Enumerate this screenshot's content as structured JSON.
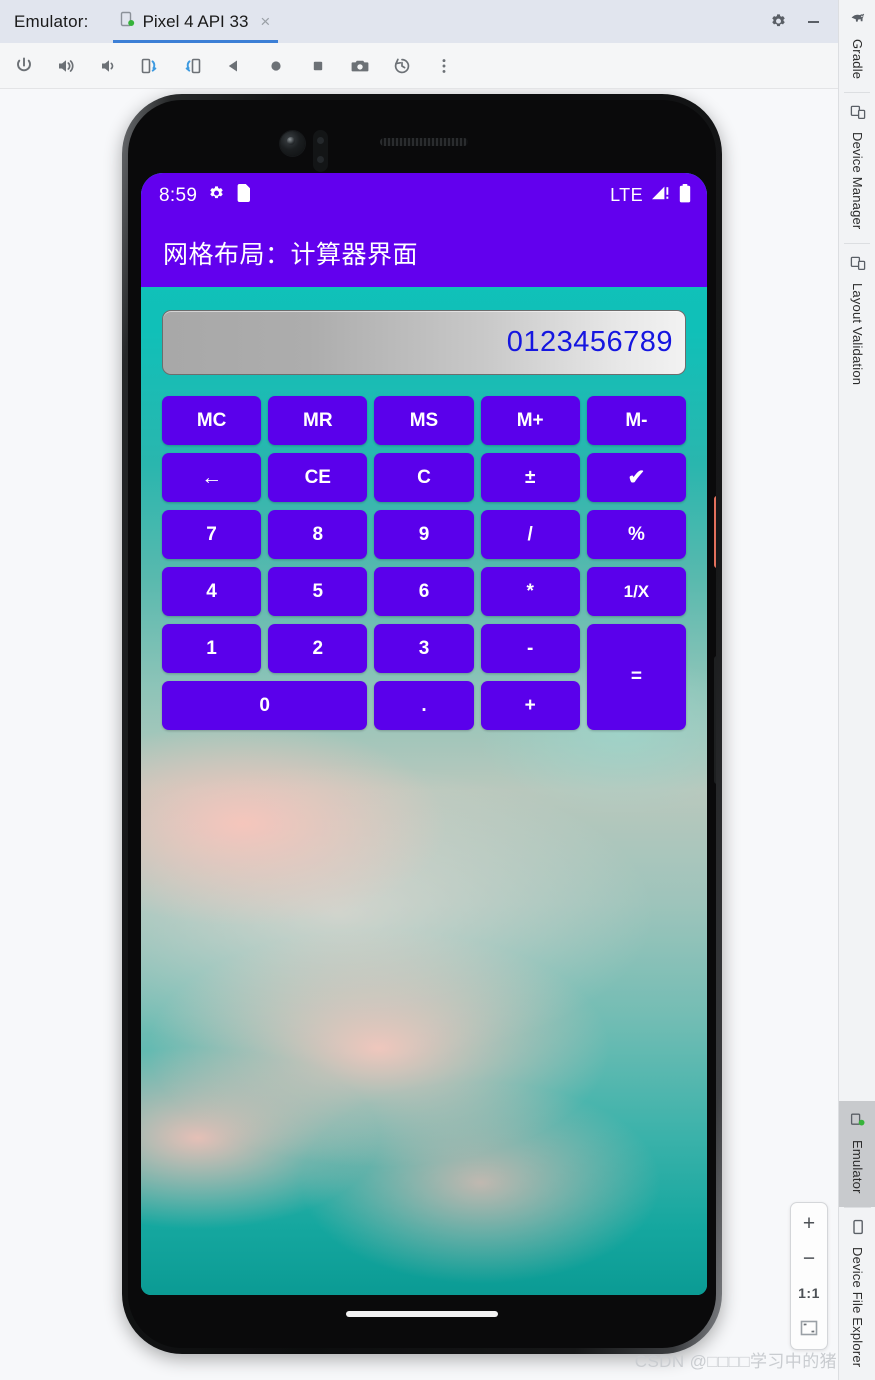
{
  "ide": {
    "window_title": "Emulator:",
    "tab": {
      "label": "Pixel 4 API 33",
      "close": "×",
      "icon": "device-phone-icon"
    },
    "header_actions": [
      {
        "name": "settings-gear",
        "icon": "gear-icon"
      },
      {
        "name": "minimize",
        "icon": "minimize-icon"
      }
    ],
    "toolbar": [
      {
        "name": "power",
        "icon": "power-icon"
      },
      {
        "name": "volume-up",
        "icon": "volume-up-icon"
      },
      {
        "name": "volume-down",
        "icon": "volume-down-icon"
      },
      {
        "name": "rotate-left",
        "icon": "rotate-left-icon"
      },
      {
        "name": "rotate-right",
        "icon": "rotate-right-icon"
      },
      {
        "name": "back",
        "icon": "back-triangle-icon"
      },
      {
        "name": "home",
        "icon": "home-circle-icon"
      },
      {
        "name": "overview",
        "icon": "overview-square-icon"
      },
      {
        "name": "screenshot",
        "icon": "camera-icon"
      },
      {
        "name": "history",
        "icon": "history-clock-icon"
      },
      {
        "name": "more",
        "icon": "more-vertical-icon"
      }
    ],
    "zoom_controls": {
      "zoom_in": "+",
      "zoom_out": "−",
      "actual_size": "1:1",
      "fit_to_screen": "fit-screen-icon"
    },
    "right_strip_top": [
      {
        "label": "Gradle",
        "icon": "gradle-elephant-icon",
        "active": false
      },
      {
        "label": "Device Manager",
        "icon": "device-manager-icon",
        "active": false
      },
      {
        "label": "Layout Validation",
        "icon": "layout-validation-icon",
        "active": false
      }
    ],
    "right_strip_bottom": [
      {
        "label": "Emulator",
        "icon": "emulator-device-icon",
        "active": true
      },
      {
        "label": "Device File Explorer",
        "icon": "device-file-explorer-icon",
        "active": false
      }
    ]
  },
  "phone": {
    "statusbar": {
      "time": "8:59",
      "icons_left": [
        "gear-icon",
        "sdcard-icon"
      ],
      "network": "LTE",
      "icons_right": [
        "signal-bar-icon",
        "battery-icon"
      ]
    },
    "appbar": {
      "title": "网格布局：计算器界面"
    }
  },
  "calculator": {
    "display": {
      "value": "0123456789",
      "text_color": "#1516e0"
    },
    "button_color": "#5a00eb",
    "accent_color": "#6200ee",
    "rows": [
      [
        {
          "label": "MC",
          "name": "memory-clear"
        },
        {
          "label": "MR",
          "name": "memory-recall"
        },
        {
          "label": "MS",
          "name": "memory-store"
        },
        {
          "label": "M+",
          "name": "memory-add"
        },
        {
          "label": "M-",
          "name": "memory-subtract"
        }
      ],
      [
        {
          "label": "←",
          "name": "backspace",
          "style": "arrow"
        },
        {
          "label": "CE",
          "name": "clear-entry"
        },
        {
          "label": "C",
          "name": "clear"
        },
        {
          "label": "±",
          "name": "sign-toggle"
        },
        {
          "label": "✔",
          "name": "confirm",
          "style": "check"
        }
      ],
      [
        {
          "label": "7",
          "name": "digit-7"
        },
        {
          "label": "8",
          "name": "digit-8"
        },
        {
          "label": "9",
          "name": "digit-9"
        },
        {
          "label": "/",
          "name": "divide"
        },
        {
          "label": "%",
          "name": "percent"
        }
      ],
      [
        {
          "label": "4",
          "name": "digit-4"
        },
        {
          "label": "5",
          "name": "digit-5"
        },
        {
          "label": "6",
          "name": "digit-6"
        },
        {
          "label": "*",
          "name": "multiply"
        },
        {
          "label": "1/X",
          "name": "reciprocal",
          "style": "small"
        }
      ],
      [
        {
          "label": "1",
          "name": "digit-1"
        },
        {
          "label": "2",
          "name": "digit-2"
        },
        {
          "label": "3",
          "name": "digit-3"
        },
        {
          "label": "-",
          "name": "subtract"
        },
        {
          "label": "=",
          "name": "equals",
          "span": "2row"
        }
      ],
      [
        {
          "label": "0",
          "name": "digit-0",
          "span": "2col"
        },
        {
          "label": ".",
          "name": "decimal-point"
        },
        {
          "label": "+",
          "name": "add"
        }
      ]
    ]
  },
  "watermark": {
    "text": "CSDN @□□□□学习中的猪"
  }
}
